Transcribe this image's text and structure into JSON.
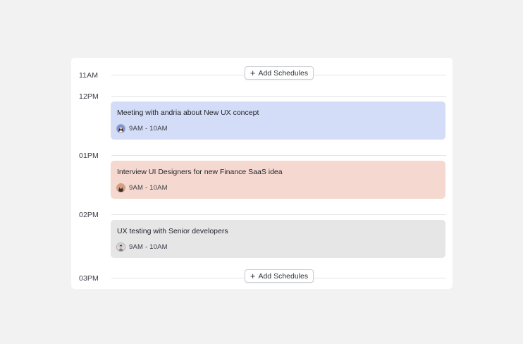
{
  "schedule": {
    "add_label": "Add Schedules",
    "add_icon": "plus-icon",
    "time_labels": [
      "11AM",
      "12PM",
      "01PM",
      "02PM",
      "03PM"
    ],
    "events": [
      {
        "title": "Meeting with andria about New UX concept",
        "time": "9AM - 10AM",
        "color": "#d4ddf7",
        "avatar": "avatar-woman-blue-icon"
      },
      {
        "title": "Interview UI Designers for new Finance SaaS idea",
        "time": "9AM - 10AM",
        "color": "#f5d9d0",
        "avatar": "avatar-woman-orange-icon"
      },
      {
        "title": "UX testing with Senior developers",
        "time": "9AM - 10AM",
        "color": "#e6e6e7",
        "avatar": "avatar-man-gray-icon"
      }
    ]
  }
}
